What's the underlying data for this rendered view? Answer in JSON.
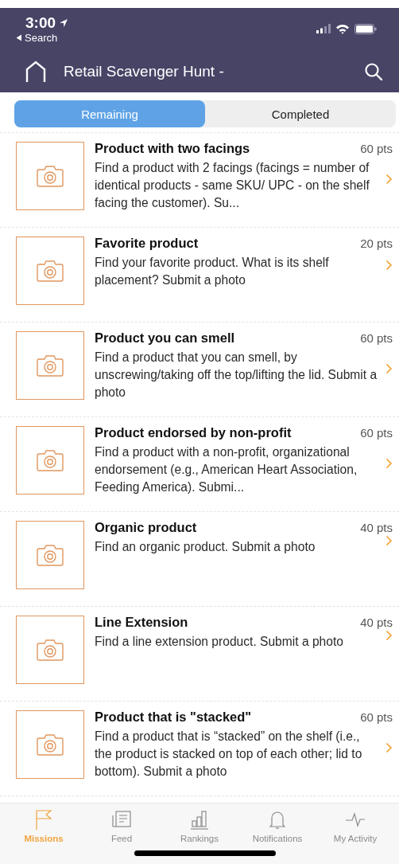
{
  "status_bar": {
    "time": "3:00",
    "back_label": "Search"
  },
  "nav_bar": {
    "title": "Retail Scavenger Hunt -"
  },
  "segments": [
    {
      "label": "Remaining",
      "selected": true
    },
    {
      "label": "Completed",
      "selected": false
    }
  ],
  "missions": [
    {
      "title": "Product with two facings",
      "points": "60 pts",
      "description": "Find a product with 2 facings (facings = number of identical products - same SKU/ UPC - on the shelf facing the customer).  Su..."
    },
    {
      "title": "Favorite product",
      "points": "20 pts",
      "description": "Find your favorite product. What is its shelf placement? Submit a photo"
    },
    {
      "title": "Product you can smell",
      "points": "60 pts",
      "description": "Find a product that you can smell, by unscrewing/taking off the top/lifting the lid. Submit a photo"
    },
    {
      "title": "Product endorsed by non-profit",
      "points": "60 pts",
      "description": "Find a product with a non-profit, organizational endorsement (e.g., American Heart Association, Feeding America). Submi..."
    },
    {
      "title": "Organic product",
      "points": "40 pts",
      "description": "Find an organic product.  Submit a photo"
    },
    {
      "title": "Line Extension",
      "points": "40 pts",
      "description": "Find a line extension product. Submit a photo"
    },
    {
      "title": "Product that is \"stacked\"",
      "points": "60 pts",
      "description": "Find a product that is “stacked” on the shelf (i.e., the product is stacked on top of each other; lid to bottom). Submit a photo"
    }
  ],
  "tab_bar": [
    {
      "label": "Missions",
      "kind": "flag",
      "selected": true
    },
    {
      "label": "Feed",
      "kind": "feed",
      "selected": false
    },
    {
      "label": "Rankings",
      "kind": "rankings",
      "selected": false
    },
    {
      "label": "Notifications",
      "kind": "bell",
      "selected": false
    },
    {
      "label": "My Activity",
      "kind": "activity",
      "selected": false
    }
  ]
}
